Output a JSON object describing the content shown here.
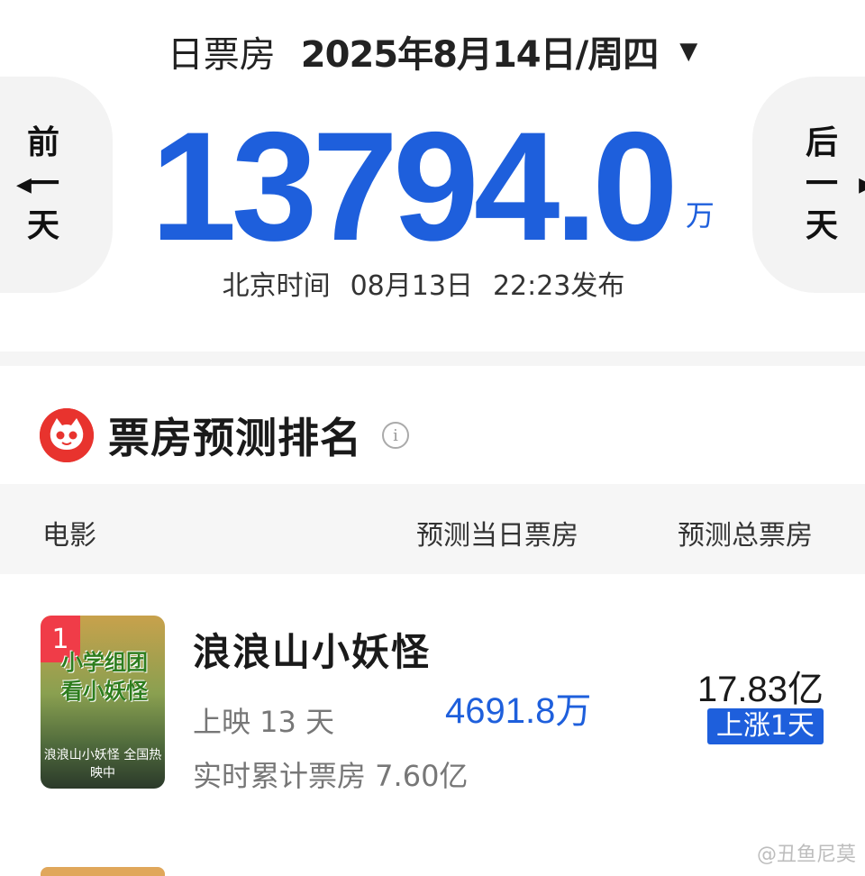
{
  "header": {
    "label": "日票房",
    "date": "2025年8月14日/周四",
    "caret": "▼"
  },
  "nav": {
    "prev": {
      "chars": [
        "前",
        "一",
        "天"
      ],
      "arrow": "◀"
    },
    "next": {
      "chars": [
        "后",
        "一",
        "天"
      ],
      "arrow": "▶"
    }
  },
  "total": {
    "value": "13794.0",
    "unit": "万"
  },
  "release": {
    "label": "北京时间",
    "date": "08月13日",
    "time": "22:23发布"
  },
  "ranking": {
    "title": "票房预测排名",
    "info_icon": "i",
    "columns": {
      "movie": "电影",
      "today": "预测当日票房",
      "total": "预测总票房"
    },
    "items": [
      {
        "rank": "1",
        "name": "浪浪山小妖怪",
        "days": "上映 13 天",
        "cumulative": "实时累计票房 7.60亿",
        "today_forecast": "4691.8万",
        "total_forecast": "17.83亿",
        "trend": "上涨1天",
        "poster_lines": [
          "小学组团",
          "看小妖怪"
        ],
        "poster_caption": "浪浪山小妖怪 全国热映中"
      }
    ]
  },
  "watermark": "@丑鱼尼莫",
  "colors": {
    "accent_blue": "#1e5fdc",
    "brand_red": "#e8332e",
    "rank_badge": "#f03c48"
  }
}
